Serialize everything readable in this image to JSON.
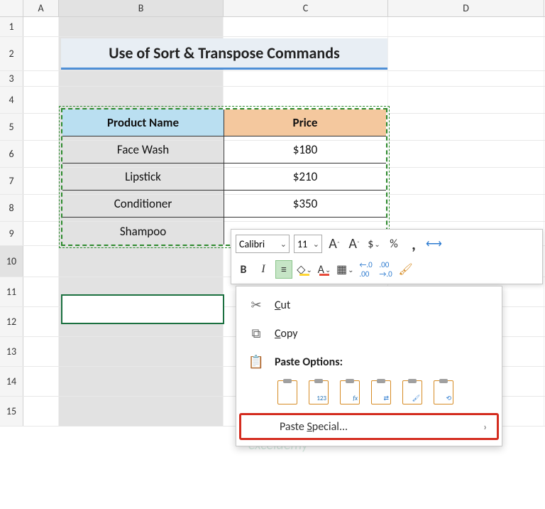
{
  "columns": [
    "A",
    "B",
    "C",
    "D"
  ],
  "rows": [
    "1",
    "2",
    "3",
    "4",
    "5",
    "6",
    "7",
    "8",
    "9",
    "10",
    "11",
    "12",
    "13",
    "14",
    "15"
  ],
  "title": "Use of Sort & Transpose Commands",
  "table": {
    "headers": {
      "product": "Product Name",
      "price": "Price"
    },
    "rows": [
      {
        "product": "Face Wash",
        "price": "$180"
      },
      {
        "product": "Lipstick",
        "price": "$210"
      },
      {
        "product": "Conditioner",
        "price": "$350"
      },
      {
        "product": "Shampoo",
        "price": ""
      }
    ]
  },
  "mini": {
    "font": "Calibri",
    "size": "11",
    "bold": "B",
    "italic": "I",
    "growA": "A",
    "shrinkA": "A",
    "dollar": "$",
    "pct": "%",
    "comma": ",",
    "incdec": ".00",
    "decdec": ".00",
    "alignA": "A",
    "colorA": "A",
    "fill": "",
    "border": "",
    "brush": "",
    "autofit": "↔"
  },
  "ctx": {
    "cut": "Cut",
    "copy": "Copy",
    "pasteOptions": "Paste Options:",
    "pasteSpecial": "Paste Special...",
    "sub123": "123",
    "subfx": "fx"
  },
  "watermark": "exceldemy"
}
